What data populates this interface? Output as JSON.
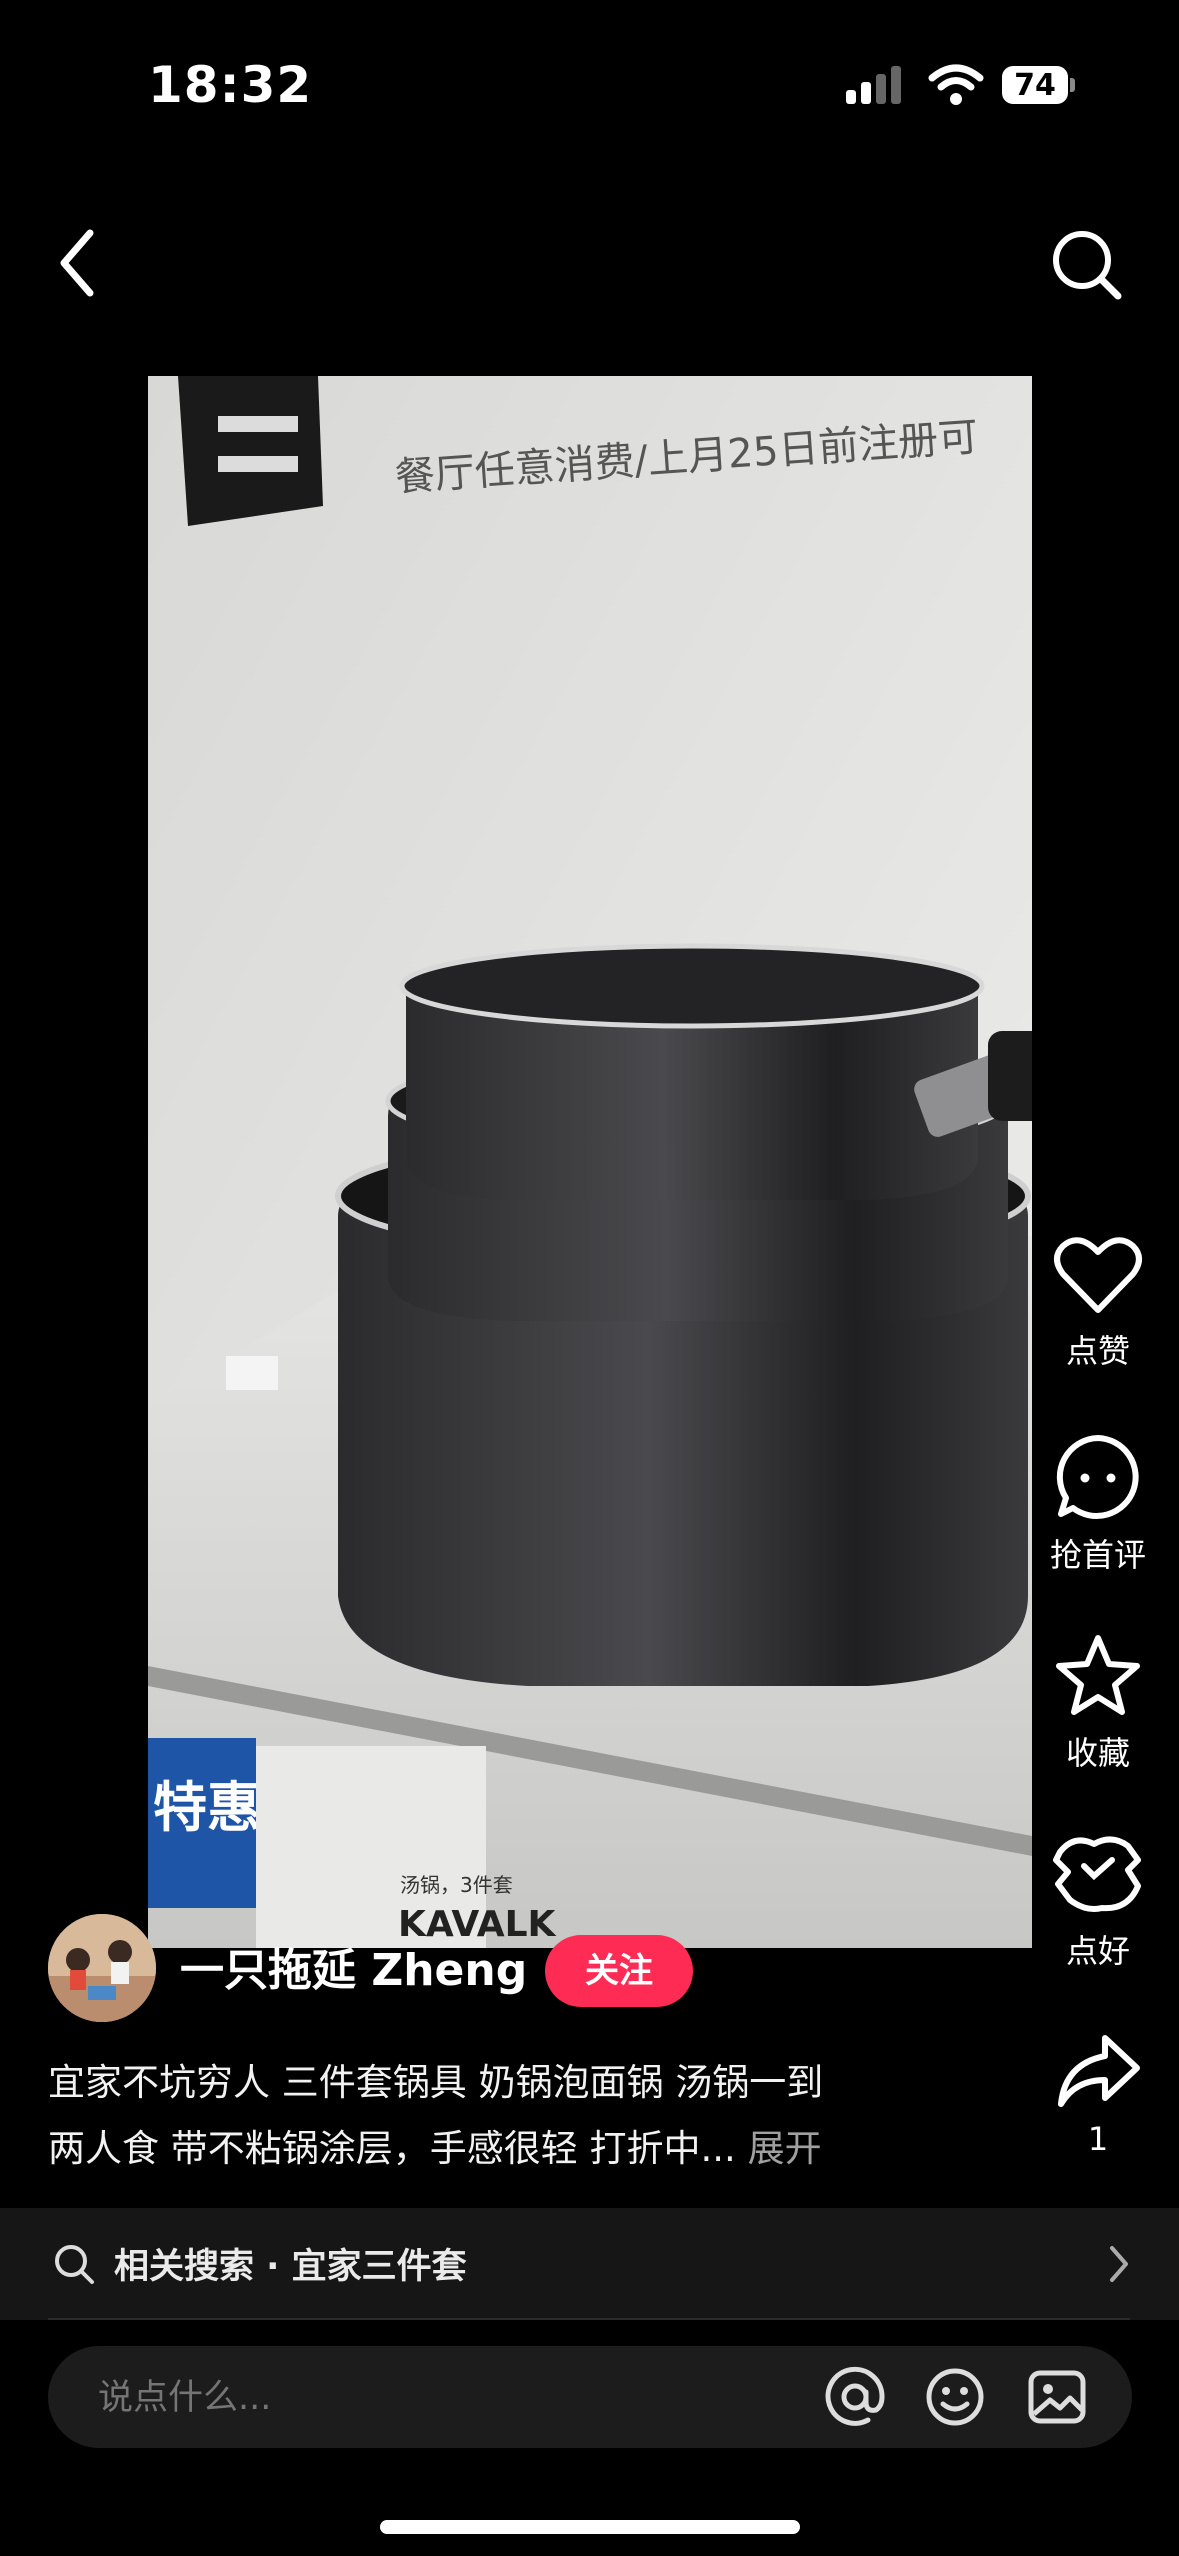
{
  "status_bar": {
    "time": "18:32",
    "battery": "74",
    "icons": [
      "signal-icon",
      "wifi-icon",
      "battery-icon"
    ]
  },
  "nav": {
    "back_icon": "chevron-left-icon",
    "search_icon": "search-icon"
  },
  "video": {
    "sign_text": "餐厅任意消费/上月25日前注册可",
    "price_tag_label": "特惠",
    "product_label_small": "汤锅，3件套",
    "product_label_brand": "KAVALK"
  },
  "side_actions": [
    {
      "icon": "heart-icon",
      "label": "点赞"
    },
    {
      "icon": "comment-icon",
      "label": "抢首评"
    },
    {
      "icon": "star-icon",
      "label": "收藏"
    },
    {
      "icon": "good-icon",
      "label": "点好"
    },
    {
      "icon": "share-icon",
      "label": "1"
    }
  ],
  "author": {
    "name": "一只拖延 Zheng",
    "follow_label": "关注"
  },
  "description": {
    "line1": "宜家不坑穷人 三件套锅具 奶锅泡面锅 汤锅一到",
    "line2": "两人食 带不粘锅涂层，手感很轻 打折中...",
    "more": " 展开"
  },
  "related_search": {
    "text": "相关搜索 · 宜家三件套"
  },
  "comment_bar": {
    "placeholder": "说点什么..."
  },
  "colors": {
    "accent": "#fe2c55",
    "background": "#000000"
  }
}
